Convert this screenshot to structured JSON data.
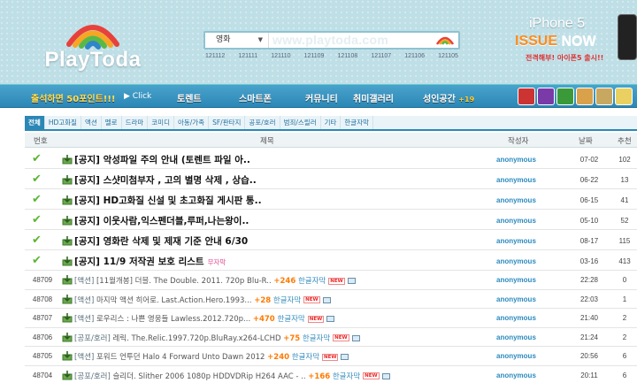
{
  "header": {
    "logo_text": "PlayToda",
    "search": {
      "category": "영화",
      "watermark": "www.playtoda.com",
      "keywords": [
        "121112",
        "121111",
        "121110",
        "121109",
        "121108",
        "121107",
        "121106",
        "121105"
      ]
    },
    "ad": {
      "title": "iPhone 5",
      "issue": "ISSUE",
      "now": "NOW",
      "subtitle": "전격해부! 아이폰5 출시!!"
    }
  },
  "nav": {
    "promo": "출석하면 50포인트!!!",
    "click": "Click",
    "items": [
      "토렌트",
      "스마트폰",
      "커뮤니티",
      "취미갤러리",
      "성인공간"
    ],
    "adult_badge": "+19"
  },
  "categories": [
    "전체",
    "HD고화질",
    "액션",
    "멜로",
    "드라마",
    "코미디",
    "아동/가족",
    "SF/판타지",
    "공포/호러",
    "범죄/스릴러",
    "기타",
    "한글자막"
  ],
  "table": {
    "headers": {
      "num": "번호",
      "subject": "제목",
      "author": "작성자",
      "date": "날짜",
      "rec": "추천"
    },
    "notices": [
      {
        "subject": "[공지] 악성파일 주의 안내 (토렌트 파일 아..",
        "author": "anonymous",
        "date": "07-02",
        "rec": "102"
      },
      {
        "subject": "[공지] 스샷미첨부자 , 고의 별명 삭제 , 상습..",
        "author": "anonymous",
        "date": "06-22",
        "rec": "13"
      },
      {
        "subject": "[공지] HD고화질 신설 및 초고화질 게시판 통..",
        "author": "anonymous",
        "date": "06-15",
        "rec": "41"
      },
      {
        "subject": "[공지] 이웃사람,익스펜더블,루퍼,나는왕이..",
        "author": "anonymous",
        "date": "05-10",
        "rec": "52"
      },
      {
        "subject": "[공지] 영화란 삭제 및 제재 기준 안내 6/30",
        "author": "anonymous",
        "date": "08-17",
        "rec": "115"
      },
      {
        "subject": "[공지] 11/9 저작권 보호 리스트",
        "tag": "무자막",
        "author": "anonymous",
        "date": "03-16",
        "rec": "413"
      }
    ],
    "posts": [
      {
        "num": "48709",
        "tag": "[액션]",
        "title": "[11월개봉] 더블. The Double. 2011. 720p Blu-R..",
        "points": "+246",
        "sub": "한글자막",
        "new": "NEW",
        "author": "anonymous",
        "date": "22:28",
        "rec": "0"
      },
      {
        "num": "48708",
        "tag": "[액션]",
        "title": "마지막 액션 히어로. Last.Action.Hero.1993...",
        "points": "+28",
        "sub": "한글자막",
        "new": "NEW",
        "author": "anonymous",
        "date": "22:03",
        "rec": "1"
      },
      {
        "num": "48707",
        "tag": "[액션]",
        "title": "로우리스 : 나쁜 영웅들 Lawless.2012.720p...",
        "points": "+470",
        "sub": "한글자막",
        "new": "NEW",
        "author": "anonymous",
        "date": "21:40",
        "rec": "2"
      },
      {
        "num": "48706",
        "tag": "[공포/호러]",
        "title": "레릭. The.Relic.1997.720p.BluRay.x264-LCHD",
        "points": "+75",
        "sub": "한글자막",
        "new": "NEW",
        "author": "anonymous",
        "date": "21:24",
        "rec": "2"
      },
      {
        "num": "48705",
        "tag": "[액션]",
        "title": "포워드 언투던 Halo 4 Forward Unto Dawn 2012",
        "points": "+240",
        "sub": "한글자막",
        "new": "NEW",
        "author": "anonymous",
        "date": "20:56",
        "rec": "6"
      },
      {
        "num": "48704",
        "tag": "[공포/호러]",
        "title": "슬리더. Slither 2006 1080p HDDVDRip H264 AAC - ..",
        "points": "+166",
        "sub": "한글자막",
        "new": "NEW",
        "author": "anonymous",
        "date": "20:11",
        "rec": "6"
      }
    ]
  },
  "colors": {
    "header_bg": "#bfdfe7",
    "nav_bg": "#2b87b6",
    "accent": "#2b8abf",
    "points": "#ff7a00",
    "check": "#5cb531"
  }
}
